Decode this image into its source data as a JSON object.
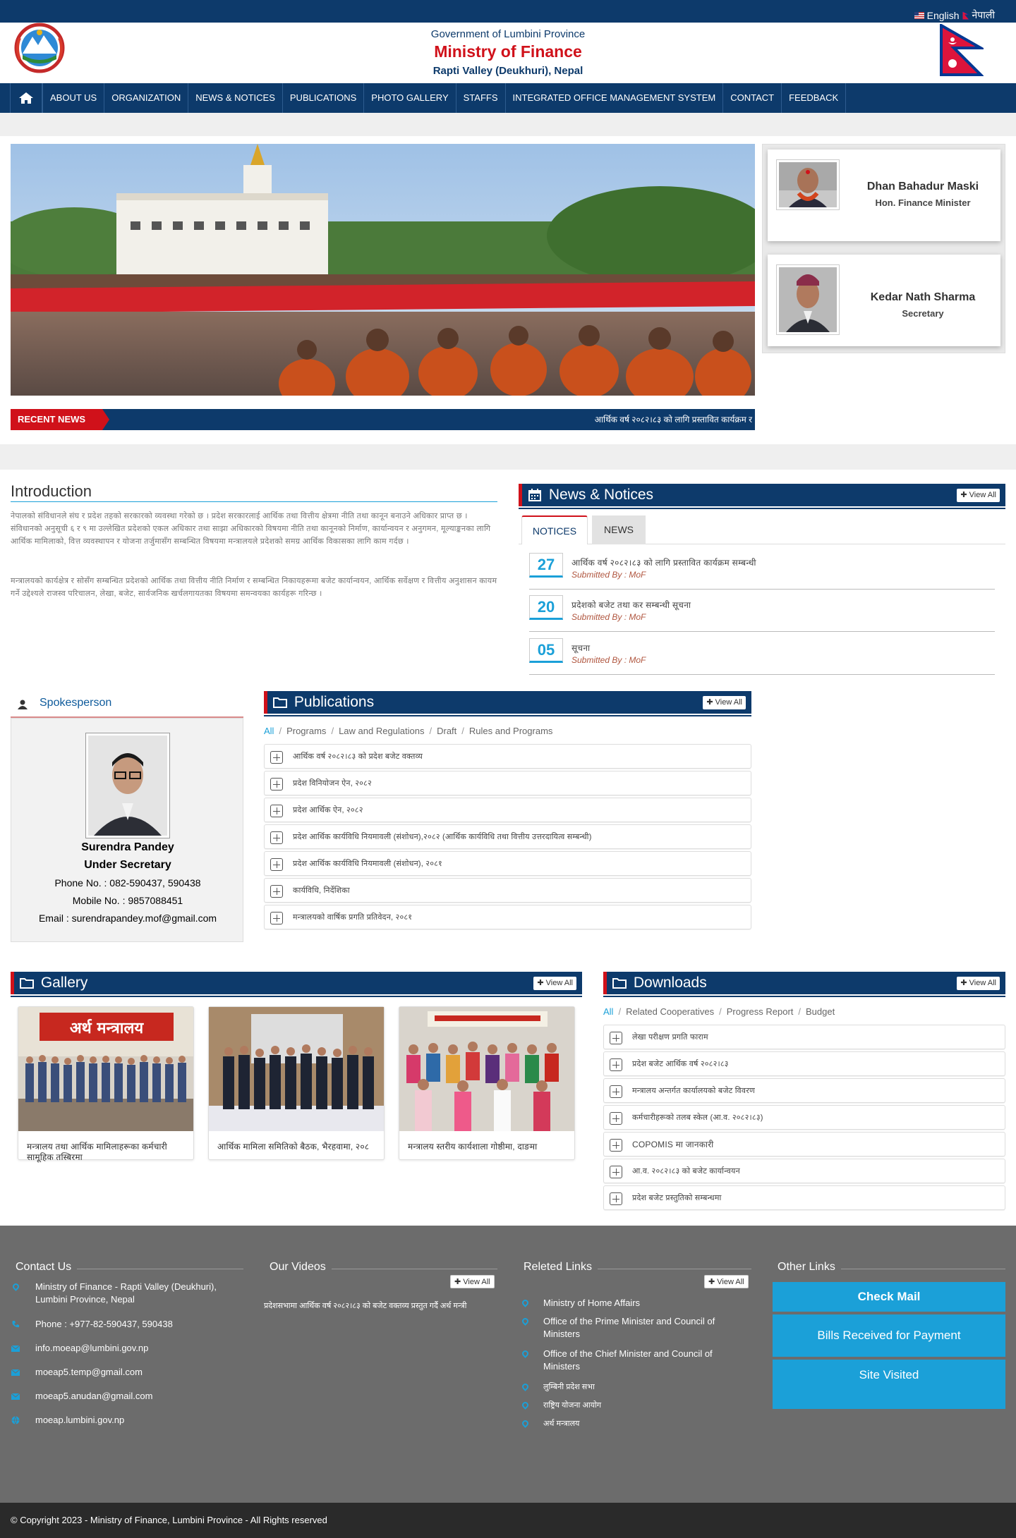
{
  "topbar": {
    "lang_english": "English",
    "lang_nepali": "नेपाली"
  },
  "header": {
    "government": "Government of Lumbini Province",
    "ministry": "Ministry of Finance",
    "location": "Rapti Valley (Deukhuri), Nepal"
  },
  "nav": {
    "items": [
      "ABOUT US",
      "ORGANIZATION",
      "NEWS & NOTICES",
      "PUBLICATIONS",
      "PHOTO GALLERY",
      "STAFFS",
      "INTEGRATED OFFICE MANAGEMENT SYSTEM",
      "CONTACT",
      "FEEDBACK"
    ]
  },
  "ticker": {
    "label": "RECENT NEWS",
    "text": "आर्थिक वर्ष २०८२।८३ को लागि प्रस्तावित कार्यक्रम र"
  },
  "profiles": [
    {
      "name": "Dhan Bahadur Maski",
      "role": "Hon. Finance Minister"
    },
    {
      "name": "Kedar Nath Sharma",
      "role": "Secretary"
    }
  ],
  "intro": {
    "title": "Introduction",
    "p1": "नेपालको संविधानले संघ र प्रदेश तहको सरकारको व्यवस्था गरेको छ । प्रदेश सरकारलाई आर्थिक तथा वित्तीय क्षेत्रमा नीति तथा कानून बनाउने अधिकार प्राप्त छ । संविधानको अनुसूची ६ र ९ मा उल्लेखित प्रदेशको एकल अधिकार तथा साझा अधिकारको विषयमा नीति तथा कानूनको निर्माण, कार्यान्वयन र अनुगमन, मूल्याङ्कनका लागि आर्थिक मामिलाको, वित्त व्यवस्थापन र योजना तर्जुमासँग सम्बन्धित विषयमा मन्त्रालयले प्रदेशको समग्र आर्थिक विकासका लागि काम गर्दछ ।",
    "p2": "मन्त्रालयको कार्यक्षेत्र र सोसँग सम्बन्धित प्रदेशको आर्थिक तथा वित्तीय नीति निर्माण र सम्बन्धित निकायहरूमा बजेट कार्यान्वयन, आर्थिक सर्वेक्षण र वित्तीय अनुशासन कायम गर्ने उद्देश्यले राजस्व परिचालन, लेखा, बजेट, सार्वजनिक खर्चलगायतका विषयमा समन्वयका कार्यहरू गरिन्छ ।"
  },
  "news": {
    "title": "News & Notices",
    "view_all": "View All",
    "tabs": [
      "NOTICES",
      "NEWS"
    ],
    "items": [
      {
        "day": "27",
        "title": "आर्थिक वर्ष २०८२।८३ को लागि प्रस्तावित कार्यक्रम सम्बन्धी",
        "submitted": "Submitted By : MoF"
      },
      {
        "day": "20",
        "title": "प्रदेशको बजेट तथा कर सम्बन्धी सूचना",
        "submitted": "Submitted By : MoF"
      },
      {
        "day": "05",
        "title": "सूचना",
        "submitted": "Submitted By : MoF"
      }
    ]
  },
  "spokesperson": {
    "title": "Spokesperson",
    "name": "Surendra Pandey",
    "role": "Under Secretary",
    "phone": "Phone No. : 082-590437, 590438",
    "mobile": "Mobile No. : 9857088451",
    "email": "Email : surendrapandey.mof@gmail.com"
  },
  "publications": {
    "title": "Publications",
    "view_all": "View All",
    "filters": [
      "All",
      "Programs",
      "Law and Regulations",
      "Draft",
      "Rules and Programs"
    ],
    "items": [
      "आर्थिक वर्ष २०८२।८३ को प्रदेश बजेट वक्तव्य",
      "प्रदेश विनियोजन ऐन, २०८२",
      "प्रदेश आर्थिक ऐन, २०८२",
      "प्रदेश आर्थिक कार्यविधि नियमावली (संशोधन),२०८२ (आर्थिक कार्यविधि तथा वित्तीय उत्तरदायित्व सम्बन्धी)",
      "प्रदेश आर्थिक कार्यविधि नियमावली (संशोधन), २०८१",
      "कार्यविधि, निर्देशिका",
      "मन्त्रालयको वार्षिक प्रगति प्रतिवेदन, २०८१"
    ]
  },
  "gallery": {
    "title": "Gallery",
    "view_all": "View All",
    "items": [
      {
        "caption": "मन्त्रालय तथा आर्थिक मामिलाहरूका कर्मचारी सामूहिक तस्बिरमा"
      },
      {
        "caption": "आर्थिक मामिला समितिको बैठक, भैरहवामा, २०८"
      },
      {
        "caption": "मन्त्रालय स्तरीय कार्यशाला गोष्ठीमा, दाङमा"
      }
    ],
    "banner_text": "अर्थ मन्त्रालय"
  },
  "downloads": {
    "title": "Downloads",
    "view_all": "View All",
    "filters": [
      "All",
      "Related Cooperatives",
      "Progress Report",
      "Budget"
    ],
    "items": [
      "लेखा परीक्षण प्रगति फाराम",
      "प्रदेश बजेट आर्थिक वर्ष २०८२।८३",
      "मन्त्रालय अन्तर्गत कार्यालयको बजेट विवरण",
      "कर्मचारीहरूको तलब स्केल (आ.व. २०८२।८३)",
      "COPOMIS मा जानकारी",
      "आ.व. २०८२।८३ को बजेट कार्यान्वयन",
      "प्रदेश बजेट प्रस्तुतिको सम्बन्धमा"
    ]
  },
  "footer": {
    "contact_title": "Contact Us",
    "address": "Ministry of Finance - Rapti Valley (Deukhuri), Lumbini Province, Nepal",
    "phone": "Phone : +977-82-590437, 590438",
    "email1": "info.moeap@lumbini.gov.np",
    "email2": "moeap5.temp@gmail.com",
    "email3": "moeap5.anudan@gmail.com",
    "website": "moeap.lumbini.gov.np",
    "videos_title": "Our Videos",
    "videos_view_all": "View All",
    "videos_text": "प्रदेशसभामा आर्थिक वर्ष २०८२।८३ को बजेट वक्तव्य प्रस्तुत गर्दै अर्थ मन्त्री",
    "links_title": "Releted Links",
    "links_view_all": "View All",
    "links": [
      "Ministry of Home Affairs",
      "Office of the Prime Minister and Council of Ministers",
      "Office of the Chief Minister and Council of Ministers",
      "लुम्बिनी प्रदेश सभा",
      "राष्ट्रिय योजना आयोग",
      "अर्थ मन्त्रालय"
    ],
    "other_title": "Other Links",
    "btn_mail": "Check Mail",
    "btn_bills": "Bills Received for Payment",
    "btn_visited": "Site Visited"
  },
  "copyright": "© Copyright 2023 - Ministry of Finance, Lumbini Province - All Rights reserved"
}
